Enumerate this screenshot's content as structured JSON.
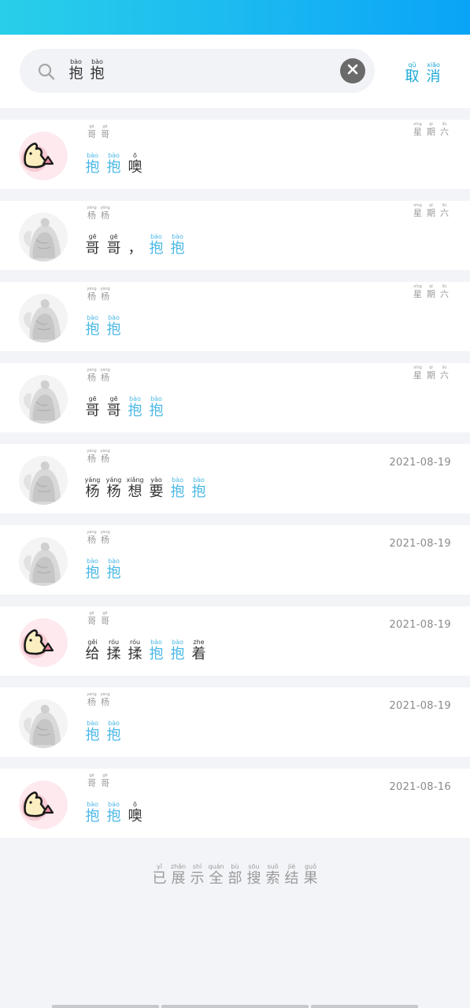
{
  "status_bar": {
    "color": "#1ab8f1"
  },
  "search": {
    "query": [
      {
        "pinyin": "bào",
        "char": "抱"
      },
      {
        "pinyin": "bào",
        "char": "抱"
      }
    ],
    "icon": "search-icon",
    "clear_icon": "close-circle-icon"
  },
  "cancel": [
    {
      "pinyin": "qǔ",
      "char": "取"
    },
    {
      "pinyin": "xiāo",
      "char": "消"
    }
  ],
  "colors": {
    "highlight": "#4bb8e6",
    "cancel": "#1aa7d8",
    "background": "#f3f4f8"
  },
  "results": [
    {
      "avatar": "cartoon",
      "sender": [
        {
          "pinyin": "gē",
          "char": "哥"
        },
        {
          "pinyin": "gē",
          "char": "哥"
        }
      ],
      "time_ruby": [
        {
          "pinyin": "xīng",
          "char": "星"
        },
        {
          "pinyin": "qī",
          "char": "期"
        },
        {
          "pinyin": "liù",
          "char": "六"
        }
      ],
      "time_text": "",
      "message": [
        {
          "pinyin": "bào",
          "char": "抱",
          "hl": true
        },
        {
          "pinyin": "bào",
          "char": "抱",
          "hl": true
        },
        {
          "pinyin": "ō",
          "char": "噢",
          "hl": false
        }
      ]
    },
    {
      "avatar": "photo",
      "sender": [
        {
          "pinyin": "yáng",
          "char": "杨"
        },
        {
          "pinyin": "yáng",
          "char": "杨"
        }
      ],
      "time_ruby": [
        {
          "pinyin": "xīng",
          "char": "星"
        },
        {
          "pinyin": "qī",
          "char": "期"
        },
        {
          "pinyin": "liù",
          "char": "六"
        }
      ],
      "time_text": "",
      "message": [
        {
          "pinyin": "gē",
          "char": "哥",
          "hl": false
        },
        {
          "pinyin": "gē",
          "char": "哥",
          "hl": false
        },
        {
          "pinyin": "",
          "char": "，",
          "hl": false
        },
        {
          "pinyin": "bào",
          "char": "抱",
          "hl": true
        },
        {
          "pinyin": "bào",
          "char": "抱",
          "hl": true
        }
      ]
    },
    {
      "avatar": "photo",
      "sender": [
        {
          "pinyin": "yáng",
          "char": "杨"
        },
        {
          "pinyin": "yáng",
          "char": "杨"
        }
      ],
      "time_ruby": [
        {
          "pinyin": "xīng",
          "char": "星"
        },
        {
          "pinyin": "qī",
          "char": "期"
        },
        {
          "pinyin": "liù",
          "char": "六"
        }
      ],
      "time_text": "",
      "message": [
        {
          "pinyin": "bào",
          "char": "抱",
          "hl": true
        },
        {
          "pinyin": "bào",
          "char": "抱",
          "hl": true
        }
      ]
    },
    {
      "avatar": "photo",
      "sender": [
        {
          "pinyin": "yáng",
          "char": "杨"
        },
        {
          "pinyin": "yáng",
          "char": "杨"
        }
      ],
      "time_ruby": [
        {
          "pinyin": "xīng",
          "char": "星"
        },
        {
          "pinyin": "qī",
          "char": "期"
        },
        {
          "pinyin": "liù",
          "char": "六"
        }
      ],
      "time_text": "",
      "message": [
        {
          "pinyin": "gē",
          "char": "哥",
          "hl": false
        },
        {
          "pinyin": "gē",
          "char": "哥",
          "hl": false
        },
        {
          "pinyin": "bào",
          "char": "抱",
          "hl": true
        },
        {
          "pinyin": "bào",
          "char": "抱",
          "hl": true
        }
      ]
    },
    {
      "avatar": "photo",
      "sender": [
        {
          "pinyin": "yáng",
          "char": "杨"
        },
        {
          "pinyin": "yáng",
          "char": "杨"
        }
      ],
      "time_ruby": [],
      "time_text": "2021-08-19",
      "message": [
        {
          "pinyin": "yáng",
          "char": "杨",
          "hl": false
        },
        {
          "pinyin": "yáng",
          "char": "杨",
          "hl": false
        },
        {
          "pinyin": "xiǎng",
          "char": "想",
          "hl": false
        },
        {
          "pinyin": "yào",
          "char": "要",
          "hl": false
        },
        {
          "pinyin": "bào",
          "char": "抱",
          "hl": true
        },
        {
          "pinyin": "bào",
          "char": "抱",
          "hl": true
        }
      ]
    },
    {
      "avatar": "photo",
      "sender": [
        {
          "pinyin": "yáng",
          "char": "杨"
        },
        {
          "pinyin": "yáng",
          "char": "杨"
        }
      ],
      "time_ruby": [],
      "time_text": "2021-08-19",
      "message": [
        {
          "pinyin": "bào",
          "char": "抱",
          "hl": true
        },
        {
          "pinyin": "bào",
          "char": "抱",
          "hl": true
        }
      ]
    },
    {
      "avatar": "cartoon",
      "sender": [
        {
          "pinyin": "gē",
          "char": "哥"
        },
        {
          "pinyin": "gē",
          "char": "哥"
        }
      ],
      "time_ruby": [],
      "time_text": "2021-08-19",
      "message": [
        {
          "pinyin": "gěi",
          "char": "给",
          "hl": false
        },
        {
          "pinyin": "róu",
          "char": "揉",
          "hl": false
        },
        {
          "pinyin": "róu",
          "char": "揉",
          "hl": false
        },
        {
          "pinyin": "bào",
          "char": "抱",
          "hl": true
        },
        {
          "pinyin": "bào",
          "char": "抱",
          "hl": true
        },
        {
          "pinyin": "zhe",
          "char": "着",
          "hl": false
        }
      ]
    },
    {
      "avatar": "photo",
      "sender": [
        {
          "pinyin": "yáng",
          "char": "杨"
        },
        {
          "pinyin": "yáng",
          "char": "杨"
        }
      ],
      "time_ruby": [],
      "time_text": "2021-08-19",
      "message": [
        {
          "pinyin": "bào",
          "char": "抱",
          "hl": true
        },
        {
          "pinyin": "bào",
          "char": "抱",
          "hl": true
        }
      ]
    },
    {
      "avatar": "cartoon",
      "sender": [
        {
          "pinyin": "gē",
          "char": "哥"
        },
        {
          "pinyin": "gē",
          "char": "哥"
        }
      ],
      "time_ruby": [],
      "time_text": "2021-08-16",
      "message": [
        {
          "pinyin": "bào",
          "char": "抱",
          "hl": true
        },
        {
          "pinyin": "bào",
          "char": "抱",
          "hl": true
        },
        {
          "pinyin": "ō",
          "char": "噢",
          "hl": false
        }
      ]
    }
  ],
  "footer": [
    {
      "pinyin": "yǐ",
      "char": "已"
    },
    {
      "pinyin": "zhǎn",
      "char": "展"
    },
    {
      "pinyin": "shì",
      "char": "示"
    },
    {
      "pinyin": "quán",
      "char": "全"
    },
    {
      "pinyin": "bù",
      "char": "部"
    },
    {
      "pinyin": "sōu",
      "char": "搜"
    },
    {
      "pinyin": "suǒ",
      "char": "索"
    },
    {
      "pinyin": "jié",
      "char": "结"
    },
    {
      "pinyin": "guǒ",
      "char": "果"
    }
  ]
}
